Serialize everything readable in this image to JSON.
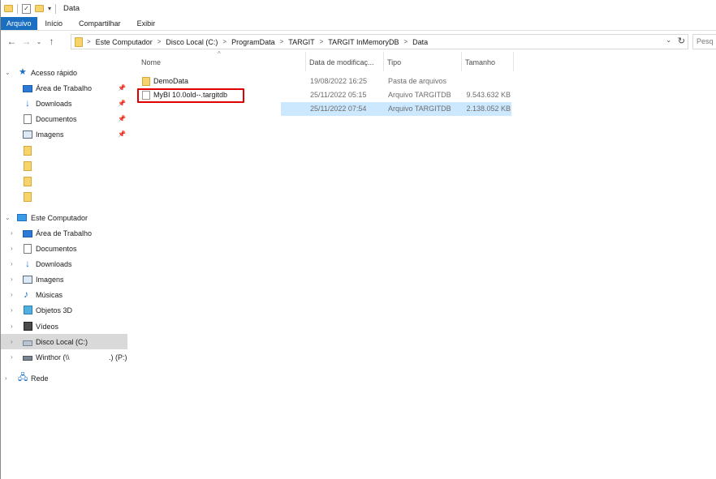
{
  "window": {
    "title": "Data"
  },
  "ribbon": {
    "tabs": [
      {
        "label": "Arquivo"
      },
      {
        "label": "Início"
      },
      {
        "label": "Compartilhar"
      },
      {
        "label": "Exibir"
      }
    ]
  },
  "address": {
    "crumbs": [
      "Este Computador",
      "Disco Local (C:)",
      "ProgramData",
      "TARGIT",
      "TARGIT InMemoryDB",
      "Data"
    ]
  },
  "search": {
    "placeholder": "Pesq"
  },
  "nav": {
    "quick_access": {
      "label": "Acesso rápido"
    },
    "quick_items": [
      {
        "label": "Área de Trabalho"
      },
      {
        "label": "Downloads"
      },
      {
        "label": "Documentos"
      },
      {
        "label": "Imagens"
      }
    ],
    "this_pc": {
      "label": "Este Computador"
    },
    "pc_items": [
      {
        "label": "Área de Trabalho"
      },
      {
        "label": "Documentos"
      },
      {
        "label": "Downloads"
      },
      {
        "label": "Imagens"
      },
      {
        "label": "Músicas"
      },
      {
        "label": "Objetos 3D"
      },
      {
        "label": "Vídeos"
      },
      {
        "label": "Disco Local (C:)"
      },
      {
        "label": "Winthor (\\\\",
        "suffix": ".) (P:)"
      }
    ],
    "network": {
      "label": "Rede"
    }
  },
  "columns": {
    "name": "Nome",
    "date": "Data de modificaç...",
    "type": "Tipo",
    "size": "Tamanho"
  },
  "files": [
    {
      "name": "DemoData",
      "date": "19/08/2022 16:25",
      "type": "Pasta de arquivos",
      "size": ""
    },
    {
      "name": "MyBI 10.0old--.targitdb",
      "date": "25/11/2022 05:15",
      "type": "Arquivo TARGITDB",
      "size": "9.543.632 KB"
    },
    {
      "name": "",
      "date": "25/11/2022 07:54",
      "type": "Arquivo TARGITDB",
      "size": "2.138.052 KB"
    }
  ]
}
